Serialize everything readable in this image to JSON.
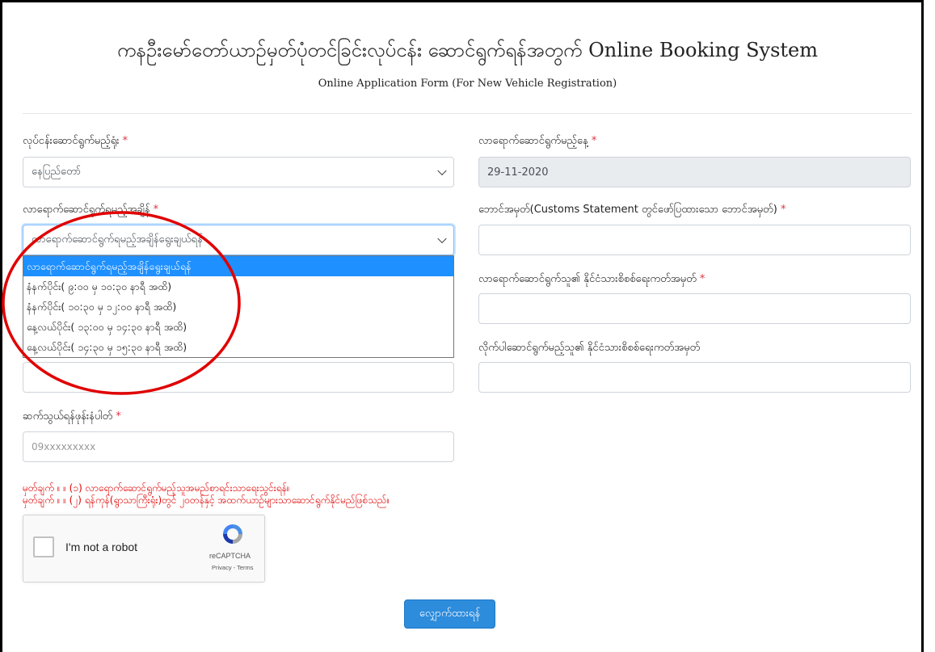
{
  "page": {
    "title": "ကနဦးမော်တော်ယာဉ်မှတ်ပုံတင်ခြင်းလုပ်ငန်း ဆောင်ရွက်ရန်အတွက် Online Booking System",
    "subtitle": "Online Application Form (For New Vehicle Registration)"
  },
  "form": {
    "office": {
      "label": "လုပ်ငန်းဆောင်ရွက်မည့်ရုံး",
      "required": "*",
      "value": "နေပြည်တော်"
    },
    "date": {
      "label": "လာရောက်ဆောင်ရွက်မည့်နေ့",
      "required": "*",
      "value": "29-11-2020"
    },
    "time": {
      "label": "လာရောက်ဆောင်ရွက်ရမည့်အချိန်",
      "required": "*",
      "value": "လာရောက်ဆောင်ရွက်ရမည့်အချိန်ရွေးချယ်ရန်",
      "options": [
        "လာရောက်ဆောင်ရွက်ရမည့်အချိန်ရွေးချယ်ရန်",
        "နံနက်ပိုင်း( ၉:၀၀ မှ ၁၀:၃၀ နာရီ အထိ)",
        "နံနက်ပိုင်း( ၁၀:၃၀ မှ ၁၂:၀၀ နာရီ အထိ)",
        "နေ့လယ်ပိုင်း( ၁၃:၀၀ မှ ၁၄:၃၀ နာရီ အထိ)",
        "နေ့လယ်ပိုင်း( ၁၄:၃၀ မှ ၁၅:၃၀ နာရီ အထိ)"
      ]
    },
    "customs_no": {
      "label": "ဘောင်အမှတ်(Customs Statement တွင်ဖော်ပြထားသော ဘောင်အမှတ်)",
      "required": "*",
      "value": ""
    },
    "nrc": {
      "label": "လာရောက်ဆောင်ရွက်သူ၏ နိုင်ငံသားစိစစ်ရေးကတ်အမှတ်",
      "required": "*",
      "value": ""
    },
    "companion_nrc": {
      "label": "လိုက်ပါဆောင်ရွက်မည့်သူ၏ နိုင်ငံသားစိစစ်ရေးကတ်အမှတ်",
      "value": ""
    },
    "phone": {
      "label": "ဆက်သွယ်ရန်ဖုန်းနံပါတ်",
      "required": "*",
      "placeholder": "09xxxxxxxxx"
    }
  },
  "notes": [
    "မှတ်ချက် ။ ။ (၁) လာရောက်ဆောင်ရွက်မည့်သူအမည်စာရင်းသာရေးသွင်းရန်။",
    "မှတ်ချက် ။ ။ (၂) ရန်ကုန်(ရွာသာကြီးရုံး)တွင် ၂၀တန်နှင့် အထက်ယာဉ်များသာဆောင်ရွက်နိုင်မည်ဖြစ်သည်။"
  ],
  "captcha": {
    "label": "I'm not a robot",
    "brand": "reCAPTCHA",
    "links": "Privacy - Terms"
  },
  "submit": {
    "label": "လျှောက်ထားရန်"
  },
  "colors": {
    "annotation": "#e00000",
    "accent": "#2d8cdc",
    "required": "#dc3545"
  },
  "icons": {
    "captcha_logo": "recaptcha-icon",
    "select_arrow": "chevron-down-icon"
  }
}
